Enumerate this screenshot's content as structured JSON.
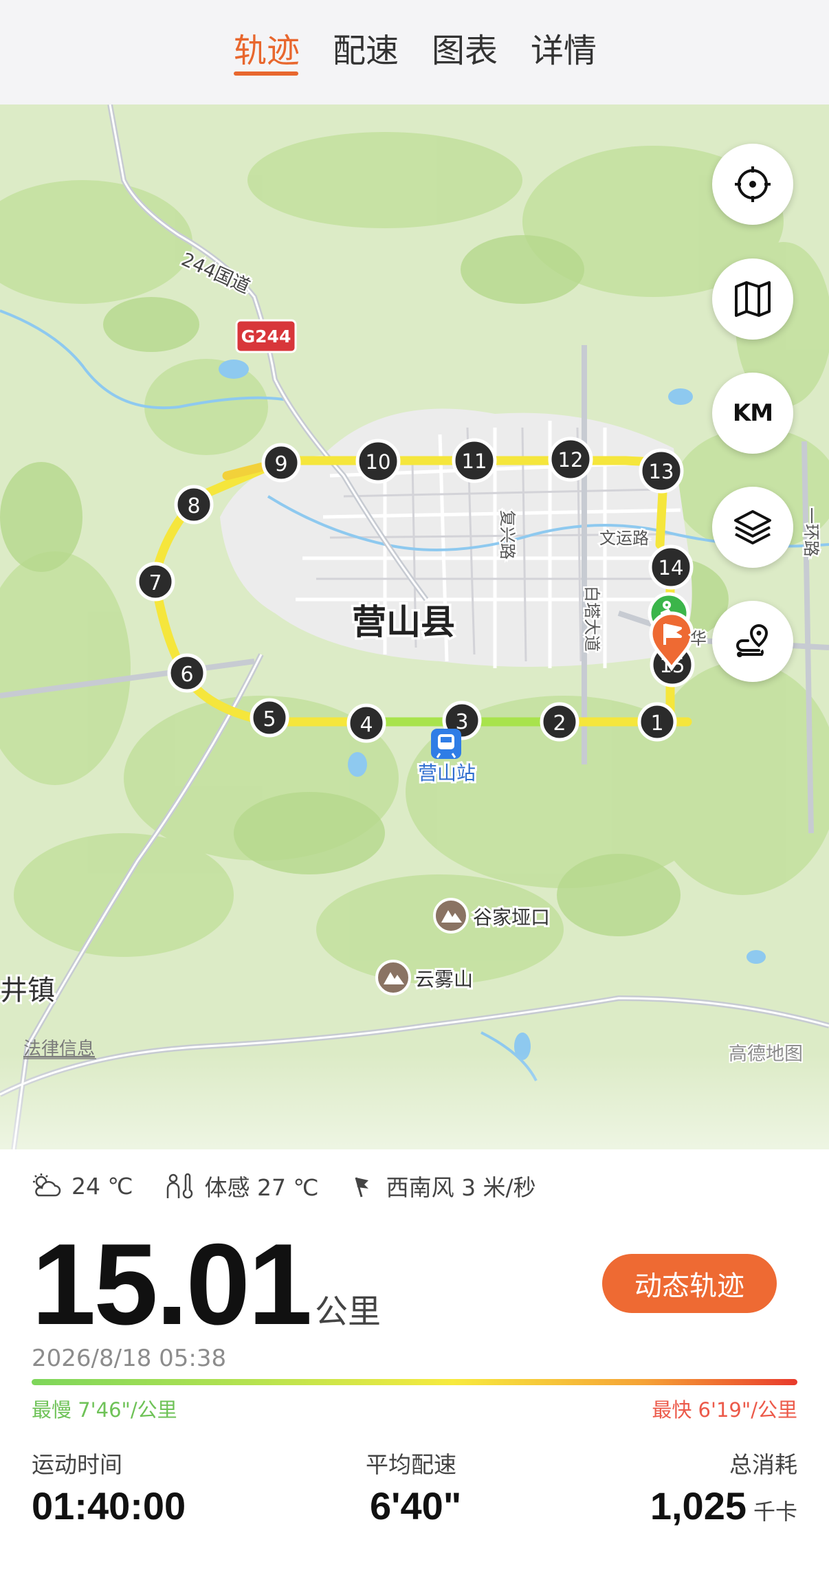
{
  "tabs": [
    {
      "label": "轨迹",
      "active": true
    },
    {
      "label": "配速",
      "active": false
    },
    {
      "label": "图表",
      "active": false
    },
    {
      "label": "详情",
      "active": false
    }
  ],
  "map": {
    "city_label": "营山县",
    "station_label": "营山站",
    "road_244": "244国道",
    "highway_badge": "G244",
    "road_fuxing": "复兴路",
    "road_baita": "白塔大道",
    "road_wenyun": "文运路",
    "road_ring": "一环路",
    "road_hua": "华",
    "poi_gujia": "谷家垭口",
    "poi_yunwu": "云雾山",
    "town_label": "井镇",
    "legal_link": "法律信息",
    "map_provider": "高德地图",
    "km_markers": [
      "1",
      "2",
      "3",
      "4",
      "5",
      "6",
      "7",
      "8",
      "9",
      "10",
      "11",
      "12",
      "13",
      "14",
      "15"
    ],
    "controls": {
      "km_label": "KM"
    },
    "icons": [
      "locate-icon",
      "map-icon",
      "layers-icon",
      "route-icon",
      "start-runner-icon",
      "finish-flag-icon",
      "train-station-icon",
      "mountain-icon"
    ]
  },
  "weather": {
    "temp": "24 ℃",
    "feels_like": "体感 27 ℃",
    "wind": "西南风 3 米/秒",
    "icons": [
      "partly-cloudy-icon",
      "feels-like-icon",
      "wind-flag-icon"
    ]
  },
  "summary": {
    "distance": "15.01",
    "distance_unit": "公里",
    "dynamic_track_button": "动态轨迹",
    "datetime": "2026/8/18 05:38",
    "slowest": "最慢 7'46\"/公里",
    "fastest": "最快 6'19\"/公里"
  },
  "stats": {
    "time_label": "运动时间",
    "time_value": "01:40:00",
    "pace_label": "平均配速",
    "pace_value": "6'40\"",
    "calories_label": "总消耗",
    "calories_value": "1,025",
    "calories_unit": "千卡"
  },
  "colors": {
    "accent": "#e8672e",
    "button": "#ee6a33",
    "route_fast": "#f5e63c",
    "route_slow": "#a8e34c",
    "map_green": "#c9e5a6",
    "slow_text": "#6ec257",
    "fast_text": "#ec5a4a"
  }
}
